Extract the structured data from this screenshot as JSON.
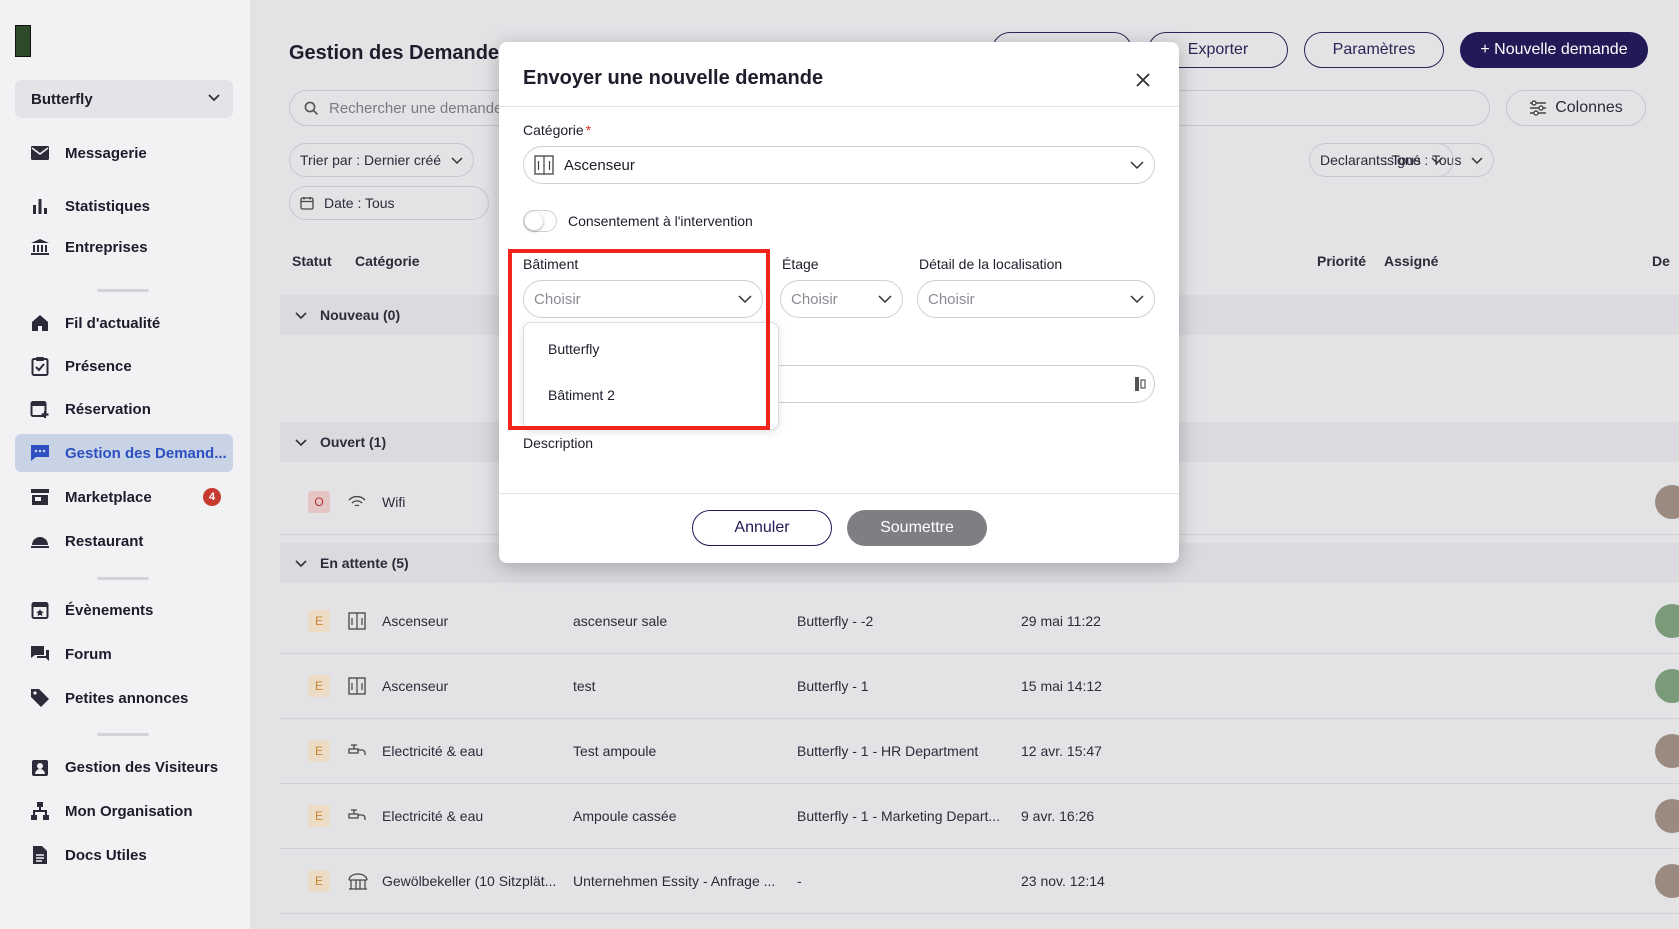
{
  "sidebar": {
    "org_select": "Butterfly",
    "items": [
      {
        "label": "Messagerie",
        "icon": "mail-icon"
      },
      {
        "label": "Statistiques",
        "icon": "bar-chart-icon"
      },
      {
        "label": "Entreprises",
        "icon": "bank-icon"
      },
      {
        "label": "Fil d'actualité",
        "icon": "home-icon"
      },
      {
        "label": "Présence",
        "icon": "clipboard-check-icon"
      },
      {
        "label": "Réservation",
        "icon": "calendar-plus-icon"
      },
      {
        "label": "Gestion des Demand...",
        "icon": "chat-icon"
      },
      {
        "label": "Marketplace",
        "icon": "store-icon",
        "badge": "4"
      },
      {
        "label": "Restaurant",
        "icon": "cloche-icon"
      },
      {
        "label": "Évènements",
        "icon": "calendar-star-icon"
      },
      {
        "label": "Forum",
        "icon": "forum-icon"
      },
      {
        "label": "Petites annonces",
        "icon": "tag-icon"
      },
      {
        "label": "Gestion des Visiteurs",
        "icon": "badge-icon"
      },
      {
        "label": "Mon Organisation",
        "icon": "org-chart-icon"
      },
      {
        "label": "Docs Utiles",
        "icon": "document-icon"
      }
    ]
  },
  "main": {
    "title": "Gestion des Demandes",
    "header_buttons": {
      "export": "Exporter",
      "settings": "Paramètres",
      "new_request": "+ Nouvelle demande"
    },
    "search_placeholder": "Rechercher une demande",
    "columns_button": "Colonnes",
    "filters": {
      "sort": "Trier par : Dernier créé",
      "assigned": "ssigné : Tous",
      "declarant": "Declarant : Tous",
      "date": "Date : Tous"
    },
    "column_headers": {
      "status": "Statut",
      "category": "Catégorie",
      "priority": "Priorité",
      "assigned": "Assigné",
      "last": "De"
    },
    "groups": {
      "new": "Nouveau (0)",
      "open": "Ouvert (1)",
      "pending": "En attente (5)"
    },
    "open_rows": [
      {
        "status": "O",
        "category": "Wifi"
      }
    ],
    "pending_rows": [
      {
        "status": "E",
        "category": "Ascenseur",
        "subject": "ascenseur sale",
        "location": "Butterfly - -2",
        "date": "29 mai 11:22"
      },
      {
        "status": "E",
        "category": "Ascenseur",
        "subject": "test",
        "location": "Butterfly - 1",
        "date": "15 mai 14:12"
      },
      {
        "status": "E",
        "category": "Electricité & eau",
        "subject": "Test ampoule",
        "location": "Butterfly - 1 - HR Department",
        "date": "12 avr. 15:47"
      },
      {
        "status": "E",
        "category": "Electricité & eau",
        "subject": "Ampoule cassée",
        "location": "Butterfly - 1 - Marketing Depart...",
        "date": "9 avr. 16:26"
      },
      {
        "status": "E",
        "category": "Gewölbekeller (10 Sitzplät...",
        "subject": "Unternehmen Essity - Anfrage ...",
        "location": "-",
        "date": "23 nov. 12:14"
      }
    ]
  },
  "modal": {
    "title": "Envoyer une nouvelle demande",
    "category_label": "Catégorie",
    "required_mark": "*",
    "category_value": "Ascenseur",
    "consent_label": "Consentement à l'intervention",
    "building_label": "Bâtiment",
    "floor_label": "Étage",
    "location_detail_label": "Détail de la localisation",
    "placeholder": "Choisir",
    "building_options": [
      "Butterfly",
      "Bâtiment 2"
    ],
    "description_label": "Description",
    "cancel": "Annuler",
    "submit": "Soumettre"
  },
  "colors": {
    "primary": "#211a56",
    "highlight": "#f0241a",
    "active_nav": "#2d4fc2",
    "badge": "#c63a2f"
  }
}
